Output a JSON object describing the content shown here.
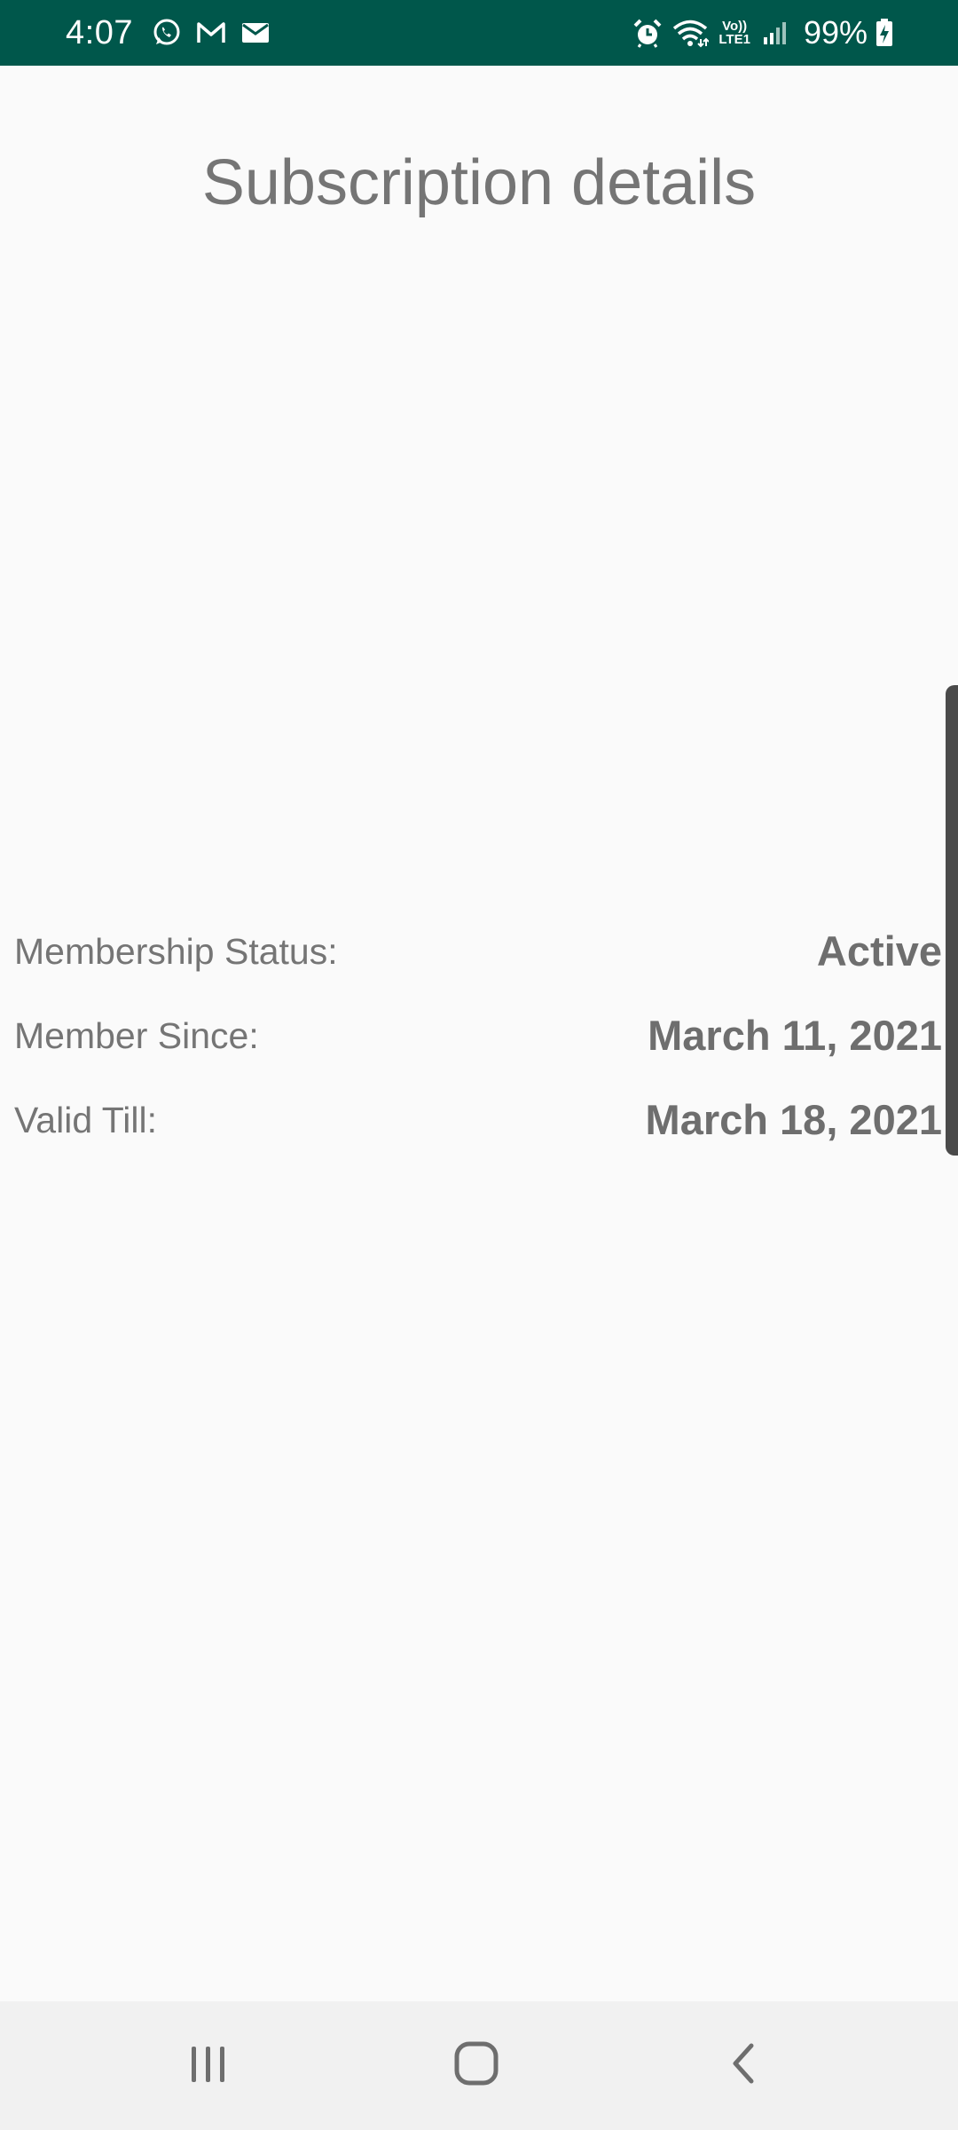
{
  "status_bar": {
    "time": "4:07",
    "left_icons": [
      "whatsapp-icon",
      "gmail-icon",
      "email-icon"
    ],
    "right_icons": [
      "alarm-icon",
      "wifi-icon",
      "volte-icon",
      "signal-icon",
      "battery-charging-icon"
    ],
    "volte_top": "Vo))",
    "volte_bottom": "LTE1",
    "battery": "99%",
    "background_color": "#00574b"
  },
  "page": {
    "title": "Subscription details"
  },
  "details": [
    {
      "label": "Membership Status:",
      "value": "Active"
    },
    {
      "label": "Member Since:",
      "value": "March 11, 2021"
    },
    {
      "label": "Valid Till:",
      "value": "March 18, 2021"
    }
  ],
  "navigation_bar": {
    "buttons": [
      "recent-apps-icon",
      "home-icon",
      "back-icon"
    ]
  }
}
